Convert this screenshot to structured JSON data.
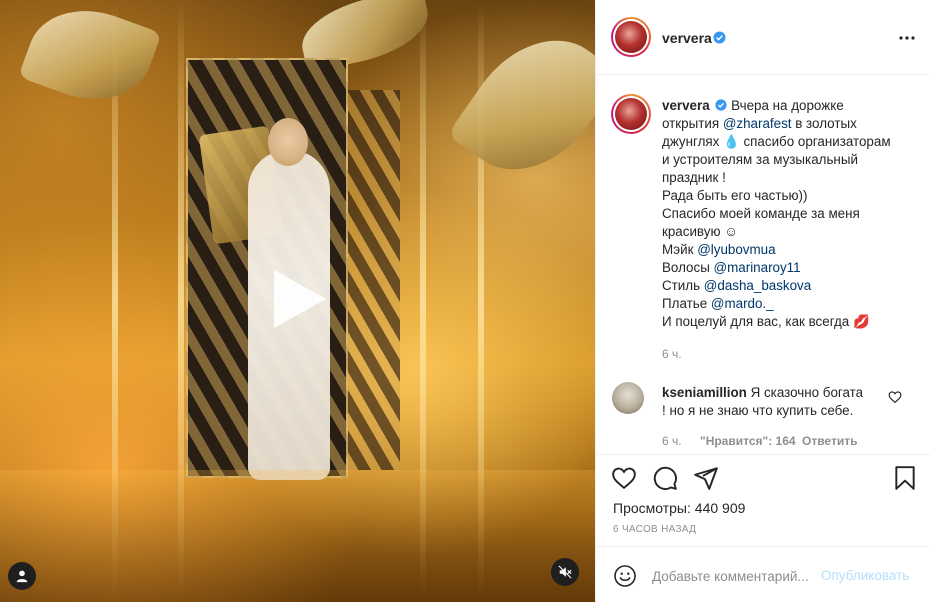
{
  "post": {
    "username": "ververa",
    "verified": true,
    "caption_lines": [
      "Вчера на дорожке",
      "открытия ",
      "джунглях",
      "и устроителям за музыкальный",
      "праздник !",
      "Рада быть его частью))",
      "Спасибо моей команде за меня",
      "красивую ☺",
      "Мэйк ",
      "Волосы ",
      "Стиль ",
      "Платье ",
      "И поцелуй для вас, как всегда 💋"
    ],
    "caption_mentions": {
      "zharafest": "@zharafest",
      "lyubovmua": "@lyubovmua",
      "marinaroy11": "@marinaroy11",
      "dasha_baskova": "@dasha_baskova",
      "mardo": "@mardo._"
    },
    "caption_fragments": {
      "after_zharafest": " в золотых",
      "drop_and_thanks": " 💧 спасибо организаторам"
    },
    "caption_time": "6 ч."
  },
  "comment": {
    "username": "kseniamillion",
    "text_line1": "Я сказочно богата",
    "text_line2": "! но я не знаю что купить себе.",
    "time": "6 ч.",
    "likes": "\"Нравится\": 164",
    "reply_label": "Ответить"
  },
  "stats": {
    "views_label": "Просмотры:",
    "views_value": "440 909",
    "posted_ago": "6 ЧАСОВ НАЗАД"
  },
  "compose": {
    "placeholder": "Добавьте комментарий...",
    "publish_label": "Опубликовать"
  },
  "colors": {
    "mention": "#00376b",
    "publish_disabled": "#b2dffc",
    "muted": "#8e8e8e",
    "verified": "#3897f0"
  },
  "icons": {
    "more": "more-horizontal-icon",
    "heart": "heart-icon",
    "comment": "comment-icon",
    "share": "share-icon",
    "save": "bookmark-icon",
    "emoji": "emoji-icon",
    "play": "play-icon",
    "user": "user-icon",
    "mute": "mute-icon"
  }
}
